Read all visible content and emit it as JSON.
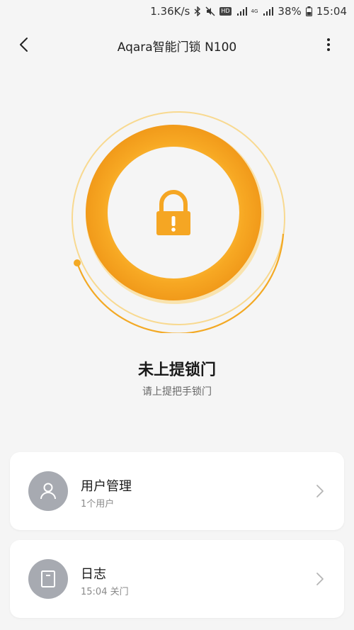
{
  "status_bar": {
    "network_speed": "1.36K/s",
    "battery": "38%",
    "time": "15:04",
    "hd_badge": "HD",
    "net_type": "4G"
  },
  "header": {
    "title": "Aqara智能门锁 N100"
  },
  "lock_status": {
    "title": "未上提锁门",
    "subtitle": "请上提把手锁门",
    "accent_color": "#f5a623"
  },
  "cards": [
    {
      "title": "用户管理",
      "subtitle": "1个用户",
      "icon": "user-icon"
    },
    {
      "title": "日志",
      "subtitle": "15:04 关门",
      "icon": "log-icon"
    }
  ]
}
